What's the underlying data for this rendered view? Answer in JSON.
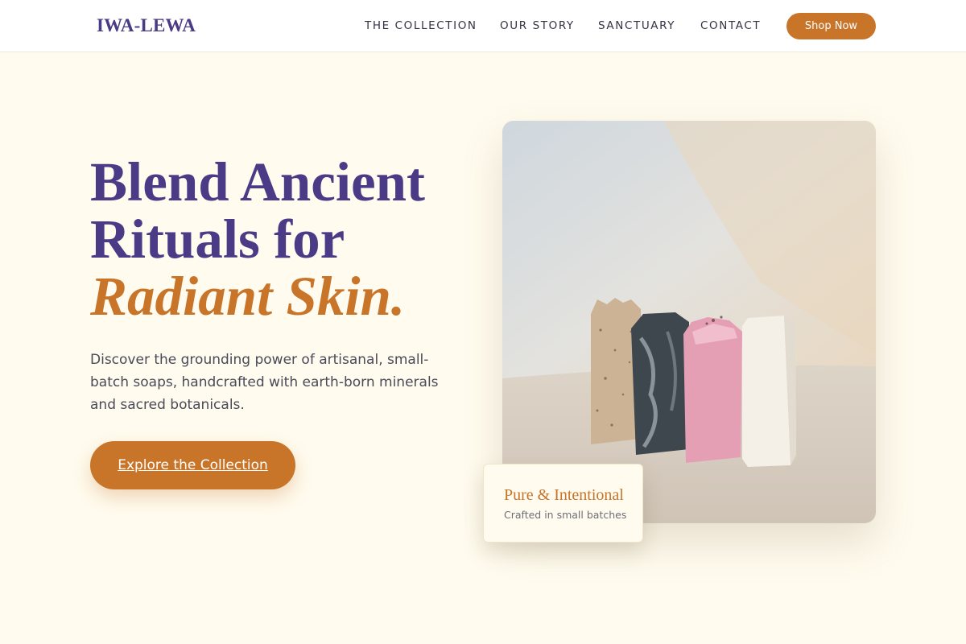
{
  "header": {
    "logo": "IWA-LEWA",
    "nav": [
      "THE COLLECTION",
      "OUR STORY",
      "SANCTUARY",
      "CONTACT"
    ],
    "shop_button": "Shop Now"
  },
  "hero": {
    "title_line1": "Blend Ancient",
    "title_line2": "Rituals for",
    "title_accent": "Radiant Skin.",
    "description": "Discover the grounding power of artisanal, small-batch soaps, handcrafted with earth-born minerals and sacred botanicals.",
    "cta": "Explore the Collection"
  },
  "image": {
    "badge_title": "Pure & Intentional",
    "badge_subtitle": "Crafted in small batches"
  },
  "colors": {
    "brand_purple": "#4b3b86",
    "accent_orange": "#c8752a",
    "background": "#fffbee"
  }
}
